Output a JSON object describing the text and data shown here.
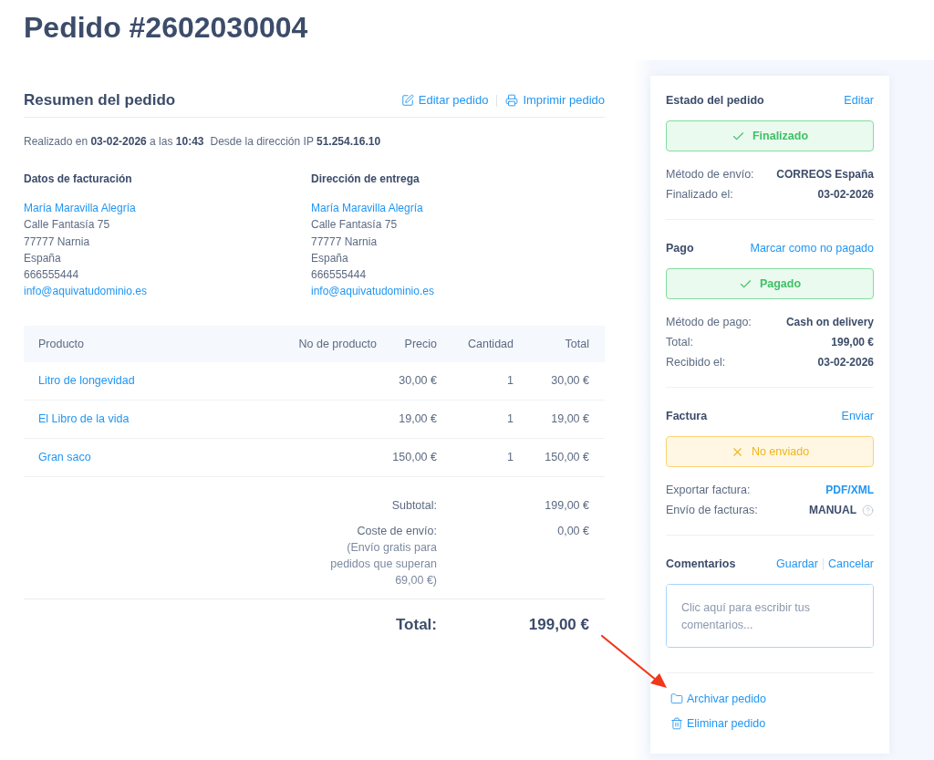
{
  "page": {
    "title": "Pedido #2602030004"
  },
  "summary": {
    "title": "Resumen del pedido",
    "actions": [
      {
        "label": "Editar pedido"
      },
      {
        "label": "Imprimir pedido"
      }
    ],
    "placed": "Realizado en **03-02-2026** a las **10:43**",
    "ip": "Desde la dirección IP **51.254.16.10**"
  },
  "addresses": [
    {
      "heading": "Datos de facturación",
      "name": "María Maravilla Alegría",
      "lines": [
        "Calle Fantasía 75",
        "77777 Narnia",
        "España",
        "666555444"
      ],
      "email": "info@aquivatudominio.es"
    },
    {
      "heading": "Dirección de entrega",
      "name": "María Maravilla Alegría",
      "lines": [
        "Calle Fantasía 75",
        "77777 Narnia",
        "España",
        "666555444"
      ],
      "email": "info@aquivatudominio.es"
    }
  ],
  "table": {
    "columns": [
      "Producto",
      "No de producto",
      "Precio",
      "Cantidad",
      "Total"
    ],
    "rows": [
      {
        "product": "Litro de longevidad",
        "price": "30,00 €",
        "quantity": "1",
        "total": "30,00 €"
      },
      {
        "product": "El Libro de la vida",
        "price": "19,00 €",
        "quantity": "1",
        "total": "19,00 €"
      },
      {
        "product": "Gran saco",
        "price": "150,00 €",
        "quantity": "1",
        "total": "150,00 €"
      }
    ]
  },
  "totals": {
    "lines": [
      {
        "label": "Subtotal:",
        "value": "199,00 €"
      },
      {
        "label": "Coste de envío:",
        "note": "(Envío gratis para pedidos que superan 69,00 €)",
        "value": "0,00 €"
      }
    ],
    "grand_total": {
      "label": "Total:",
      "value": "199,00 €"
    }
  },
  "sidebar": {
    "sections": [
      {
        "kind": "status",
        "title": "Estado del pedido",
        "actions": [
          "Editar"
        ],
        "status": {
          "label": "Finalizado",
          "ok": true
        },
        "rows": [
          {
            "label": "Método de envío:",
            "value": "CORREOS España"
          },
          {
            "label": "Finalizado el:",
            "value": "03-02-2026"
          }
        ]
      },
      {
        "kind": "status",
        "title": "Pago",
        "actions": [
          "Marcar como no pagado"
        ],
        "status": {
          "label": "Pagado",
          "ok": true
        },
        "rows": [
          {
            "label": "Método de pago:",
            "value": "Cash on delivery"
          },
          {
            "label": "Total:",
            "value": "199,00 €"
          },
          {
            "label": "Recibido el:",
            "value": "03-02-2026"
          }
        ]
      },
      {
        "kind": "status",
        "title": "Factura",
        "actions": [
          "Enviar"
        ],
        "status": {
          "label": "No enviado",
          "ok": false
        },
        "rows": [
          {
            "label": "Exportar factura:",
            "value": "PDF/XML",
            "link": true
          },
          {
            "label": "Envío de facturas:",
            "value": "MANUAL",
            "help": true
          }
        ]
      },
      {
        "kind": "comments",
        "title": "Comentarios",
        "actions": [
          "Guardar",
          "Cancelar"
        ],
        "placeholder": "Clic aquí para escribir tus comentarios..."
      }
    ],
    "footer_actions": [
      {
        "label": "Archivar pedido"
      },
      {
        "label": "Eliminar pedido"
      }
    ]
  }
}
